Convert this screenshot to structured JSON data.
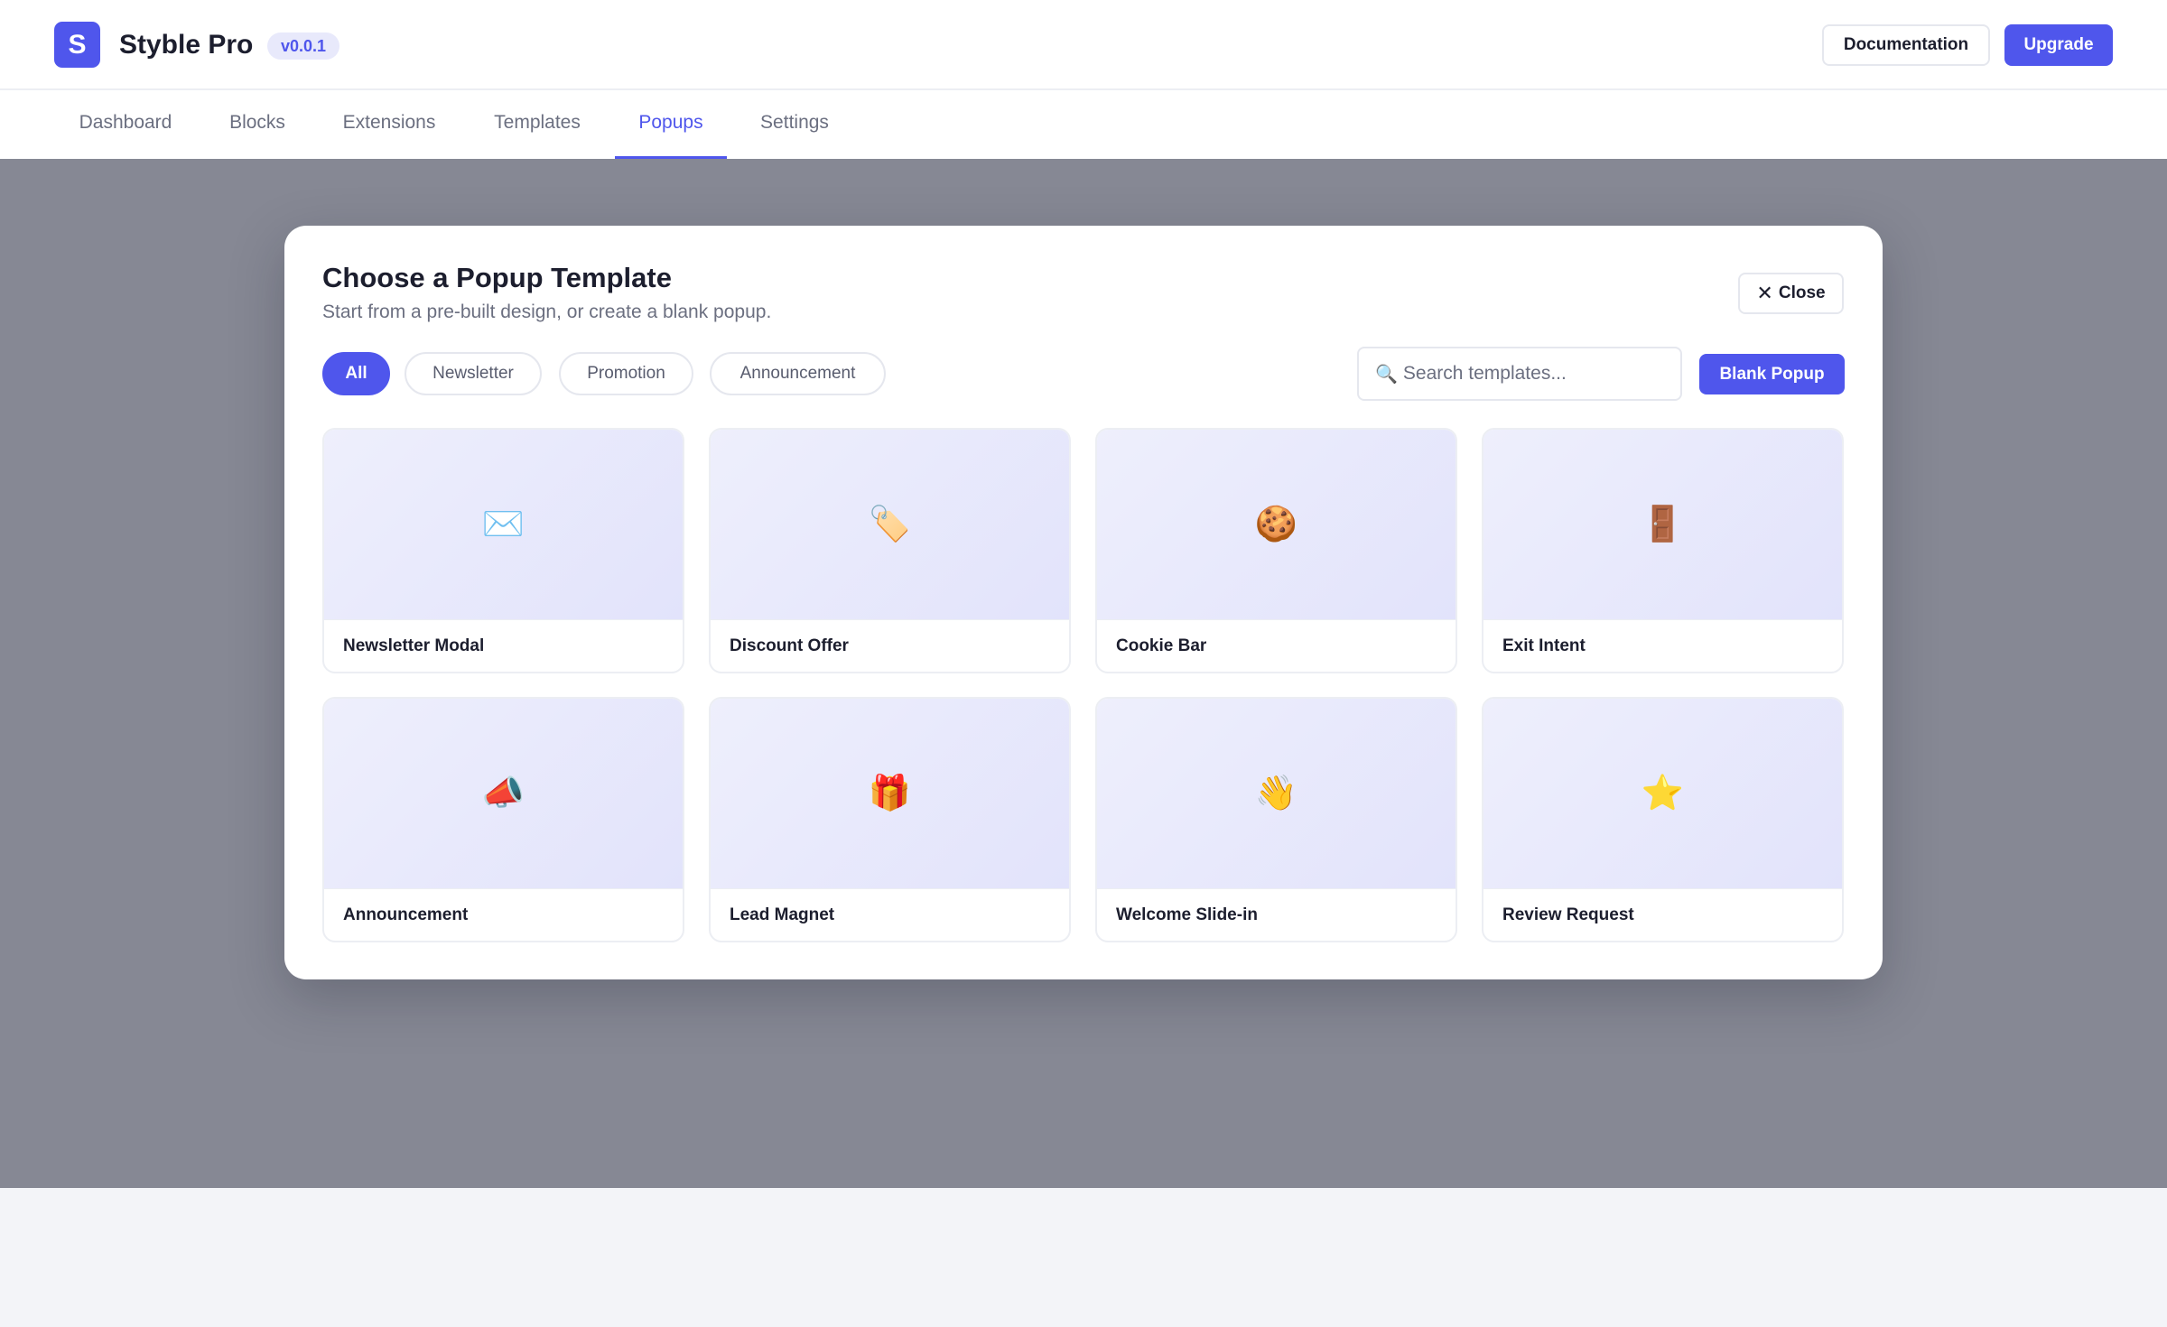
{
  "header": {
    "logo_letter": "S",
    "app_name": "Styble Pro",
    "version": "v0.0.1",
    "documentation_label": "Documentation",
    "upgrade_label": "Upgrade"
  },
  "nav": {
    "tabs": [
      {
        "label": "Dashboard"
      },
      {
        "label": "Blocks"
      },
      {
        "label": "Extensions"
      },
      {
        "label": "Templates"
      },
      {
        "label": "Popups",
        "active": true
      },
      {
        "label": "Settings"
      }
    ]
  },
  "modal": {
    "title": "Choose a Popup Template",
    "subtitle": "Start from a pre-built design, or create a blank popup.",
    "close_label": "Close",
    "filters": [
      {
        "label": "All",
        "active": true
      },
      {
        "label": "Newsletter"
      },
      {
        "label": "Promotion"
      },
      {
        "label": "Announcement"
      }
    ],
    "search_placeholder": "Search templates...",
    "search_icon": "🔍",
    "blank_popup_label": "Blank Popup",
    "templates": [
      {
        "name": "Newsletter Modal",
        "icon": "✉️"
      },
      {
        "name": "Discount Offer",
        "icon": "🏷️"
      },
      {
        "name": "Cookie Bar",
        "icon": "🍪"
      },
      {
        "name": "Exit Intent",
        "icon": "🚪"
      },
      {
        "name": "Announcement",
        "icon": "📣"
      },
      {
        "name": "Lead Magnet",
        "icon": "🎁"
      },
      {
        "name": "Welcome Slide-in",
        "icon": "👋"
      },
      {
        "name": "Review Request",
        "icon": "⭐"
      }
    ]
  },
  "colors": {
    "accent": "#4f56ec",
    "overlay": "#868894"
  }
}
